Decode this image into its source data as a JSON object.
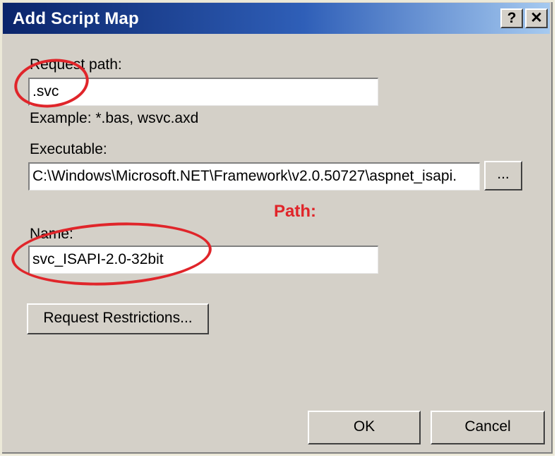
{
  "window": {
    "title": "Add Script Map",
    "help_glyph": "?",
    "close_glyph": "✕"
  },
  "request_path": {
    "label": "Request path:",
    "value": ".svc",
    "example": "Example: *.bas, wsvc.axd"
  },
  "executable": {
    "label": "Executable:",
    "value": "C:\\Windows\\Microsoft.NET\\Framework\\v2.0.50727\\aspnet_isapi.",
    "browse_label": "..."
  },
  "annotation": {
    "text": "Path:",
    "color": "#e0252a"
  },
  "name": {
    "label": "Name:",
    "value": "svc_ISAPI-2.0-32bit"
  },
  "buttons": {
    "request_restrictions": "Request Restrictions...",
    "ok": "OK",
    "cancel": "Cancel"
  }
}
